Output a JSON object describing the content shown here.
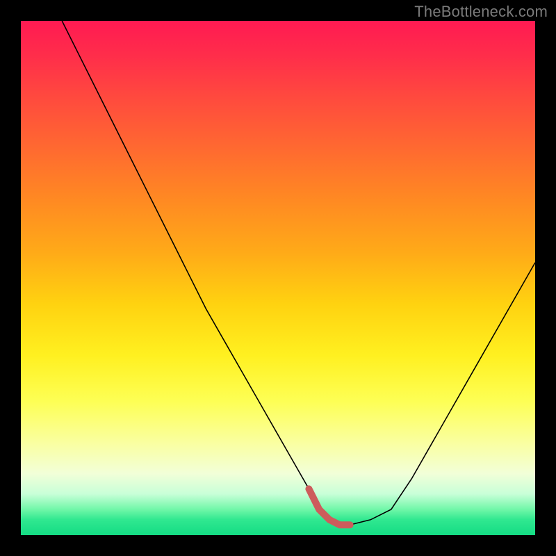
{
  "watermark": "TheBottleneck.com",
  "colors": {
    "frame": "#000000",
    "gradient_top": "#ff1a52",
    "gradient_bottom": "#14dc84",
    "curve": "#000000",
    "highlight": "#cd5c5c"
  },
  "chart_data": {
    "type": "line",
    "title": "",
    "xlabel": "",
    "ylabel": "",
    "xlim": [
      0,
      100
    ],
    "ylim": [
      0,
      100
    ],
    "x": [
      8,
      12,
      16,
      20,
      24,
      28,
      32,
      36,
      40,
      44,
      48,
      52,
      56,
      58,
      60,
      62,
      64,
      68,
      72,
      76,
      80,
      84,
      88,
      92,
      96,
      100
    ],
    "values": [
      100,
      92,
      84,
      76,
      68,
      60,
      52,
      44,
      37,
      30,
      23,
      16,
      9,
      5,
      3,
      2,
      2,
      3,
      5,
      11,
      18,
      25,
      32,
      39,
      46,
      53
    ],
    "annotations": [
      {
        "type": "highlight_range",
        "x_start": 56,
        "x_end": 67,
        "y": 2
      }
    ]
  }
}
